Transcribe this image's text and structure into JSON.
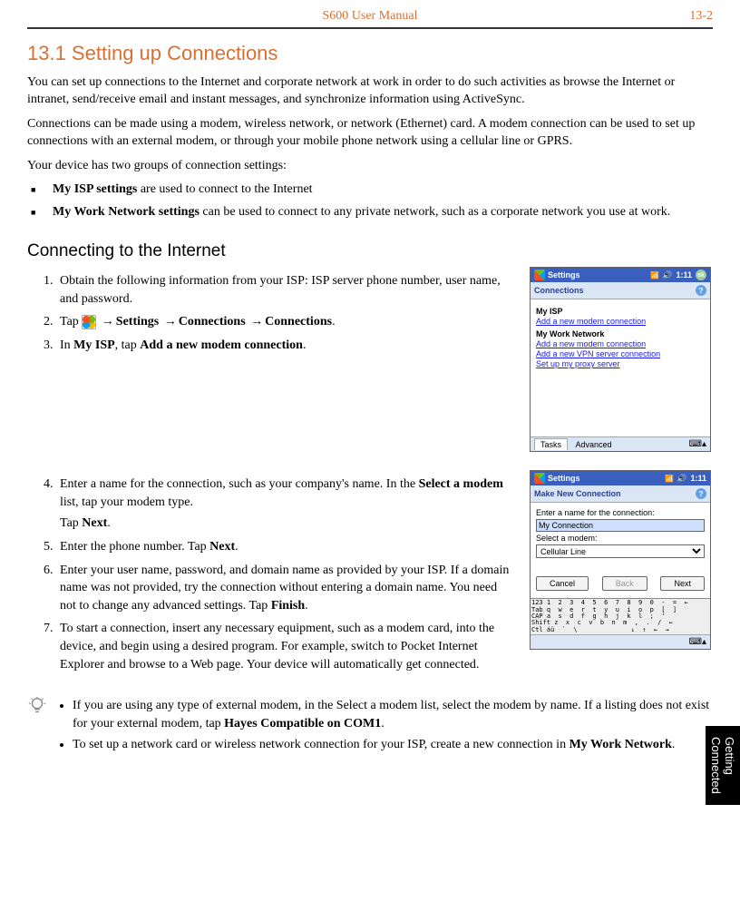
{
  "header": {
    "center": "S600 User Manual",
    "right": "13-2"
  },
  "sideTab": "Getting Connected",
  "sectionTitle": "13.1    Setting up Connections",
  "intro1": "You can set up connections to the Internet and corporate network at work in order to do such activities as browse the Internet or intranet, send/receive email and instant messages, and synchronize information using ActiveSync.",
  "intro2": "Connections can be made using a modem, wireless network, or network (Ethernet) card. A modem connection can be used to set up connections with an external modem, or through your mobile phone network using a cellular line or GPRS.",
  "intro3": "Your device has two groups of connection settings:",
  "groups": [
    {
      "strong": "My ISP settings",
      "rest": "  are used to connect to the Internet"
    },
    {
      "strong": "My Work Network settings",
      "rest": "  can be used to connect to any private network, such as a corporate network you use at work."
    }
  ],
  "subhead": "Connecting to the Internet",
  "stepsA": {
    "s1": "Obtain the following information from your ISP: ISP server phone number, user name, and password.",
    "s2_pre": "Tap ",
    "s2_a": "Settings",
    "s2_b": "Connections",
    "s2_c": "Connections",
    "s3_pre": "In ",
    "s3_strong1": "My ISP",
    "s3_mid": ", tap ",
    "s3_strong2": "Add a new modem connection",
    "s3_end": "."
  },
  "stepsB": {
    "s4_l1a": "Enter a name for the connection, such as your company's name. In the ",
    "s4_strong": "Select a modem",
    "s4_l1b": " list, tap your modem type.",
    "s4_l2a": "Tap ",
    "s4_l2strong": "Next",
    "s4_l2b": ".",
    "s5_a": "Enter the phone number. Tap ",
    "s5_strong": "Next",
    "s5_b": ".",
    "s6_a": "Enter your user name, password, and domain name as provided by your ISP. If a domain name was not provided, try the connection without entering a domain name. You need not to change any advanced settings. Tap ",
    "s6_strong": "Finish",
    "s6_b": ".",
    "s7": "To start a connection, insert any necessary equipment, such as a modem card, into the device, and begin using a desired program. For example, switch to Pocket Internet Explorer and browse to a Web page. Your device will automatically get connected."
  },
  "tips": {
    "t1a": "If you are using any type of external modem, in the Select a modem list, select the modem by name. If a listing does not exist for your external modem, tap ",
    "t1strong": "Hayes Compatible on COM1",
    "t1b": ".",
    "t2a": "To set up a network card or wireless network connection for your ISP, create a new connection in ",
    "t2strong": "My Work Network",
    "t2b": "."
  },
  "pda1": {
    "titleApp": "Settings",
    "time": "1:11",
    "subHeader": "Connections",
    "isp": "My ISP",
    "ispLink": "Add a new modem connection",
    "work": "My Work Network",
    "workLinks": [
      "Add a new modem connection",
      "Add a new VPN server connection",
      "Set up my proxy server"
    ],
    "tabs": {
      "left": "Tasks",
      "right": "Advanced"
    }
  },
  "pda2": {
    "titleApp": "Settings",
    "time": "1:11",
    "subHeader": "Make New Connection",
    "label1": "Enter a name for the connection:",
    "fieldVal": "My Connection",
    "label2": "Select a modem:",
    "selectVal": "Cellular Line",
    "btnCancel": "Cancel",
    "btnBack": "Back",
    "btnNext": "Next",
    "kbdRows": [
      "123 1  2  3  4  5  6  7  8  9  0  -  =  ←",
      "Tab q  w  e  r  t  y  u  i  o  p  [  ]",
      "CAP a  s  d  f  g  h  j  k  l  ;  '",
      "Shift z  x  c  v  b  n  m  ,  .  /  ←",
      "Ctl áü  `  \\              ↓  ↑  ←  →"
    ]
  }
}
